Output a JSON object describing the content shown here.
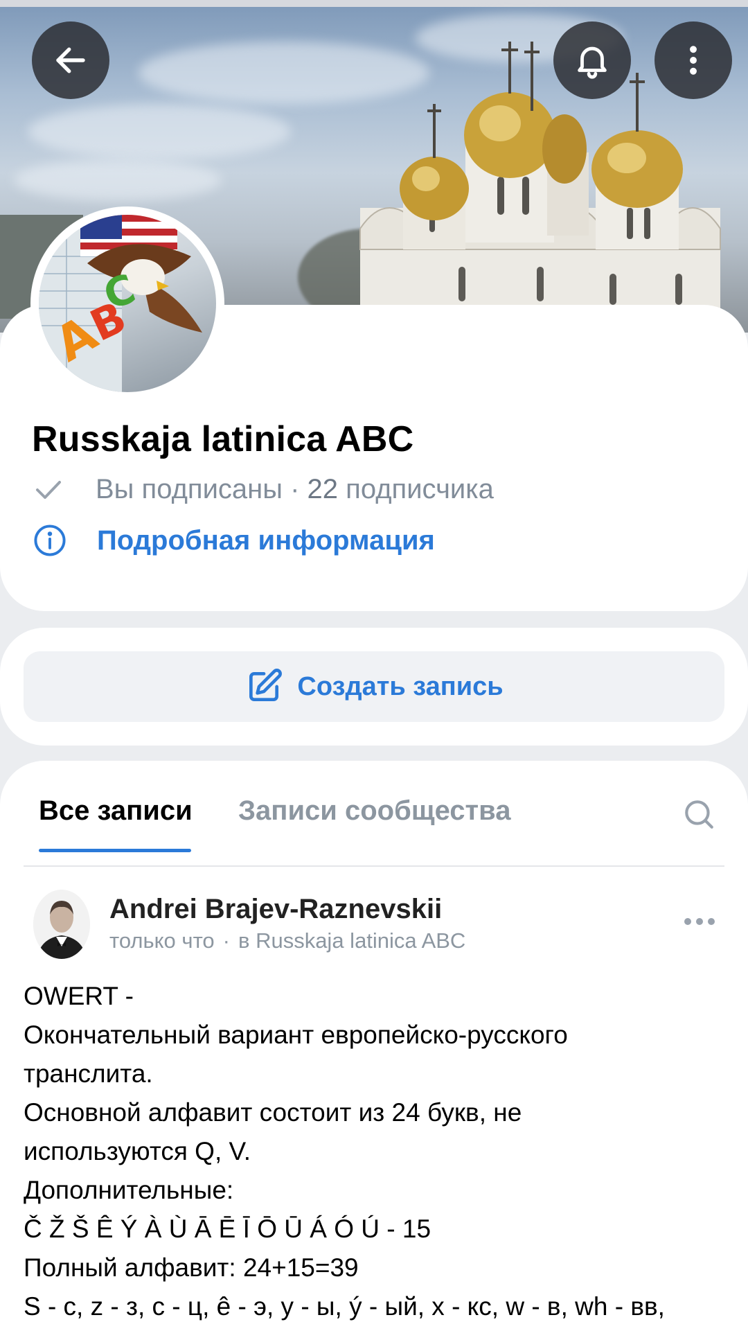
{
  "header": {
    "back_icon": "arrow-left-icon",
    "bell_icon": "bell-icon",
    "more_icon": "more-vertical-icon"
  },
  "group": {
    "name": "Russkaja latinica ABC",
    "subscribed_label": "Вы подписаны",
    "separator": " · ",
    "subscribers_count": "22",
    "subscribers_word": " подписчика",
    "details_link": "Подробная информация"
  },
  "create_post": {
    "label": "Создать запись",
    "icon": "edit-icon"
  },
  "tabs": {
    "all": "Все записи",
    "community": "Записи сообщества",
    "active": "all",
    "search_icon": "search-icon"
  },
  "post": {
    "author": "Andrei Brajev-Raznevskii",
    "time": "только что",
    "meta_separator": "·",
    "in_group": "в Russkaja latinica ABC",
    "lines": [
      "OWERT -",
      "Окончательный вариант европейско-русского",
      "транслита.",
      "Основной алфавит состоит из 24 букв, не",
      "используются Q, V.",
      "Дополнительные:",
      "Č Ž Š Ê Ý À Ù Ā Ē Ī Ō Ū Á Ó Ú - 15",
      "Полный алфавит: 24+15=39",
      "S - с, z - з, c - ц, ê - э, y - ы, ý - ый, x - кс, w - в, wh - вв,"
    ]
  },
  "colors": {
    "accent": "#2b7ad8",
    "background": "#ebedf0",
    "muted_text": "#818c99"
  }
}
